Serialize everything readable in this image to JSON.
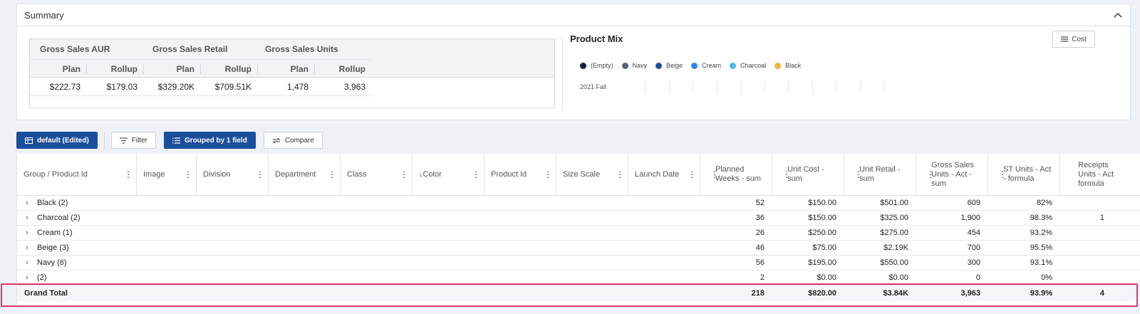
{
  "summary": {
    "title": "Summary",
    "groups": [
      "Gross Sales AUR",
      "Gross Sales Retail",
      "Gross Sales Units"
    ],
    "subheaders": [
      "Plan",
      "Rollup",
      "Plan",
      "Rollup",
      "Plan",
      "Rollup"
    ],
    "values": [
      "$222.73",
      "$179.03",
      "$329.20K",
      "$709.51K",
      "1,478",
      "3,963"
    ]
  },
  "product_mix": {
    "title": "Product Mix",
    "cost_label": "Cost",
    "legend": [
      {
        "label": "(Empty)",
        "color": "#13213d"
      },
      {
        "label": "Navy",
        "color": "#5a6478"
      },
      {
        "label": "Beige",
        "color": "#1b4f9c"
      },
      {
        "label": "Cream",
        "color": "#2f86e0"
      },
      {
        "label": "Charcoal",
        "color": "#4ab8ef"
      },
      {
        "label": "Black",
        "color": "#f2b43c"
      }
    ],
    "row_label": "2021 Fall"
  },
  "toolbar": {
    "view_label": "default (Edited)",
    "filter_label": "Filter",
    "group_label": "Grouped by 1 field",
    "compare_label": "Compare"
  },
  "grid": {
    "columns": [
      {
        "label": "Group / Product Id"
      },
      {
        "label": "Image"
      },
      {
        "label": "Division"
      },
      {
        "label": "Department"
      },
      {
        "label": "Class"
      },
      {
        "label": "Color"
      },
      {
        "label": "Product Id"
      },
      {
        "label": "Size Scale"
      },
      {
        "label": "Launch Date"
      },
      {
        "label": "Planned Weeks - sum"
      },
      {
        "label": "Unit Cost - sum"
      },
      {
        "label": "Unit Retail - sum"
      },
      {
        "label": "Gross Sales Units - Act - sum"
      },
      {
        "label": "ST Units - Act - formula"
      },
      {
        "label": "Receipts Units - Act formula"
      }
    ],
    "rows": [
      {
        "group": "Black (2)",
        "weeks": "52",
        "cost": "$150.00",
        "retail": "$501.00",
        "units": "609",
        "st": "82%",
        "receipts": ""
      },
      {
        "group": "Charcoal (2)",
        "weeks": "36",
        "cost": "$150.00",
        "retail": "$325.00",
        "units": "1,900",
        "st": "98.3%",
        "receipts": "1"
      },
      {
        "group": "Cream (1)",
        "weeks": "26",
        "cost": "$250.00",
        "retail": "$275.00",
        "units": "454",
        "st": "93.2%",
        "receipts": ""
      },
      {
        "group": "Beige (3)",
        "weeks": "46",
        "cost": "$75.00",
        "retail": "$2.19K",
        "units": "700",
        "st": "95.5%",
        "receipts": ""
      },
      {
        "group": "Navy (6)",
        "weeks": "56",
        "cost": "$195.00",
        "retail": "$550.00",
        "units": "300",
        "st": "93.1%",
        "receipts": ""
      },
      {
        "group": "(2)",
        "weeks": "2",
        "cost": "$0.00",
        "retail": "$0.00",
        "units": "0",
        "st": "0%",
        "receipts": ""
      }
    ],
    "total": {
      "label": "Grand Total",
      "weeks": "218",
      "cost": "$820.00",
      "retail": "$3.84K",
      "units": "3,963",
      "st": "93.9%",
      "receipts": "4"
    }
  },
  "colors": {
    "primary": "#1b4f9c",
    "highlight": "#e8336a"
  }
}
